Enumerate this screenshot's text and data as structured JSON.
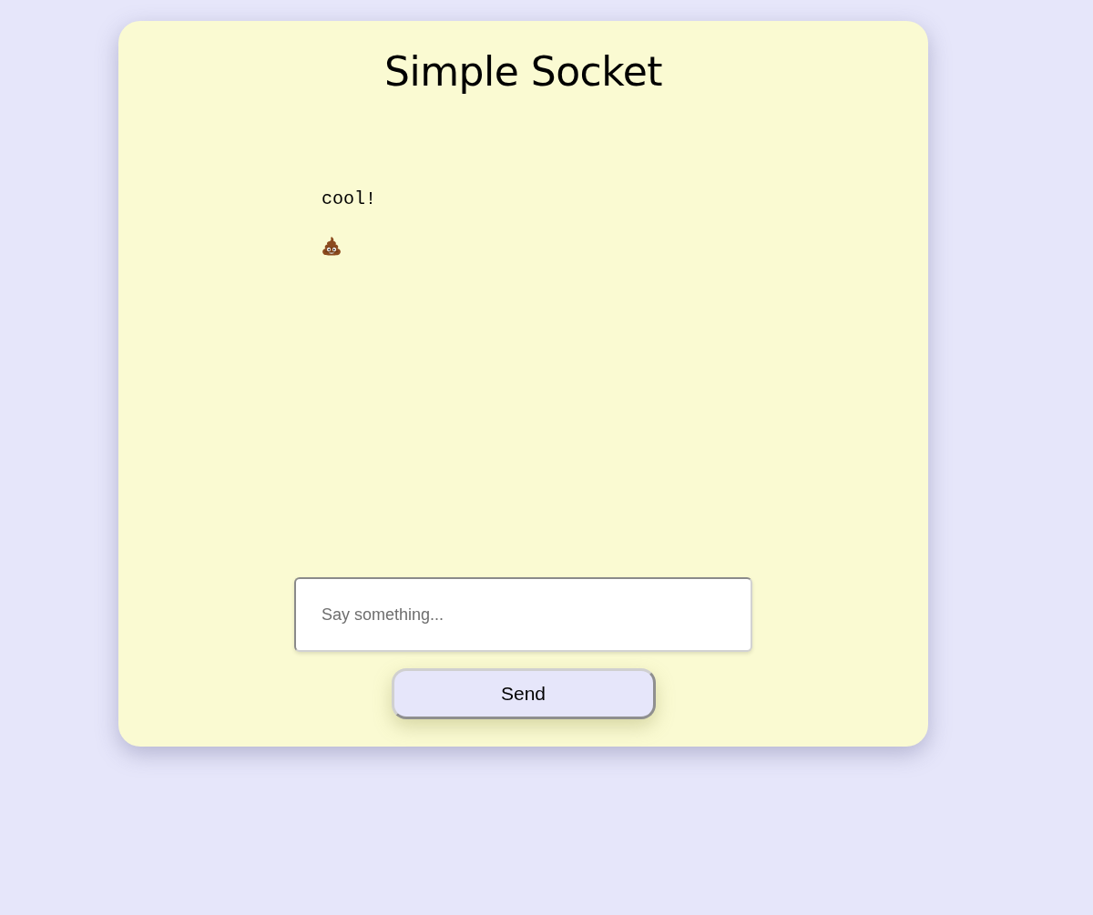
{
  "title": "Simple Socket",
  "messages": [
    {
      "kind": "text",
      "text": "cool!"
    },
    {
      "kind": "emoji"
    }
  ],
  "composer": {
    "placeholder": "Say something...",
    "button": "Send"
  }
}
